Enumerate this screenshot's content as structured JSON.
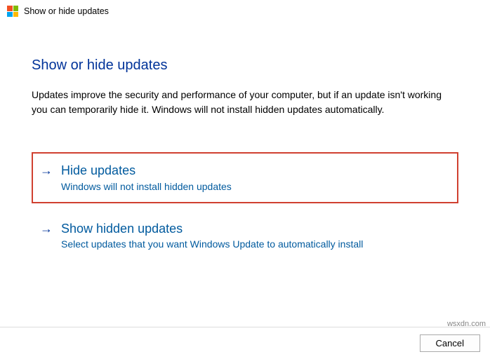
{
  "window": {
    "title": "Show or hide updates"
  },
  "page": {
    "heading": "Show or hide updates",
    "description": "Updates improve the security and performance of your computer, but if an update isn't working you can temporarily hide it. Windows will not install hidden updates automatically."
  },
  "options": [
    {
      "title": "Hide updates",
      "desc": "Windows will not install hidden updates",
      "highlighted": true
    },
    {
      "title": "Show hidden updates",
      "desc": "Select updates that you want Windows Update to automatically install",
      "highlighted": false
    }
  ],
  "footer": {
    "cancel": "Cancel"
  },
  "watermark": "wsxdn.com"
}
